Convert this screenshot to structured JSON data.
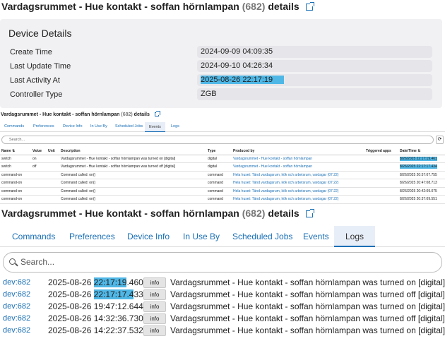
{
  "device_name": "Vardagsrummet - Hue kontakt - soffan hörnlampan",
  "device_count": "(682)",
  "details_word": "details",
  "panel1": {
    "heading": "Device Details",
    "rows": [
      {
        "label": "Create Time",
        "value": "2024-09-09 04:09:35"
      },
      {
        "label": "Last Update Time",
        "value": "2024-09-10 04:26:34"
      },
      {
        "label": "Last Activity At",
        "value": "2025-08-26 22:17:19"
      },
      {
        "label": "Controller Type",
        "value": "ZGB"
      }
    ]
  },
  "panel2": {
    "tabs": [
      "Commands",
      "Preferences",
      "Device Info",
      "In Use By",
      "Scheduled Jobs",
      "Events",
      "Logs"
    ],
    "active_tab": "Events",
    "search_placeholder": "Search...",
    "columns": [
      "Name ⇅",
      "Value",
      "Unit",
      "Description",
      "Type",
      "Produced by",
      "Triggered apps",
      "Date/Time ⇅"
    ],
    "rows": [
      [
        "switch",
        "on",
        "",
        "Vardagsrummet - Hue kontakt - soffan hörnlampan was turned on [digital]",
        "digital",
        "Vardagsrummet - Hue kontakt - soffan hörnlampan",
        "",
        "8/26/2025 22:17:19.461"
      ],
      [
        "switch",
        "off",
        "",
        "Vardagsrummet - Hue kontakt - soffan hörnlampan was turned off [digital]",
        "digital",
        "Vardagsrummet - Hue kontakt - soffan hörnlampan",
        "",
        "8/26/2025 22:17:17.434"
      ],
      [
        "command-on",
        "",
        "",
        "Command called: on()",
        "command",
        "Hela huset: Tänd vardagsrum, kök och arbetsrum, vardagar (07:22)",
        "",
        "8/26/2025 20:57:07.755"
      ],
      [
        "command-on",
        "",
        "",
        "Command called: on()",
        "command",
        "Hela huset: Tänd vardagsrum, kök och arbetsrum, vardagar (07:22)",
        "",
        "8/26/2025 20:47:08.713"
      ],
      [
        "command-on",
        "",
        "",
        "Command called: on()",
        "command",
        "Hela huset: Tänd vardagsrum, kök och arbetsrum, vardagar (07:22)",
        "",
        "8/26/2025 20:42:09.075"
      ],
      [
        "command-on",
        "",
        "",
        "Command called: on()",
        "command",
        "Hela huset: Tänd vardagsrum, kök och arbetsrum, vardagar (07:22)",
        "",
        "8/26/2025 20:37:09.551"
      ]
    ]
  },
  "panel3": {
    "tabs": [
      "Commands",
      "Preferences",
      "Device Info",
      "In Use By",
      "Scheduled Jobs",
      "Events",
      "Logs"
    ],
    "active_tab": "Logs",
    "search_placeholder": "Search...",
    "logs": [
      {
        "source": "dev:682",
        "date": "2025-08-26",
        "time": "22:17:19",
        "ms": ".460",
        "level": "info",
        "message": "Vardagsrummet - Hue kontakt - soffan hörnlampan was turned on [digital]"
      },
      {
        "source": "dev:682",
        "date": "2025-08-26",
        "time": "22:17:17.4",
        "ms": "33",
        "level": "info",
        "message": "Vardagsrummet - Hue kontakt - soffan hörnlampan was turned off [digital]"
      },
      {
        "source": "dev:682",
        "date": "2025-08-26",
        "time": "19:47:12.644",
        "ms": "",
        "level": "info",
        "message": "Vardagsrummet - Hue kontakt - soffan hörnlampan was turned on [digital]"
      },
      {
        "source": "dev:682",
        "date": "2025-08-26",
        "time": "14:32:36.730",
        "ms": "",
        "level": "info",
        "message": "Vardagsrummet - Hue kontakt - soffan hörnlampan was turned off [digital]"
      },
      {
        "source": "dev:682",
        "date": "2025-08-26",
        "time": "14:22:37.532",
        "ms": "",
        "level": "info",
        "message": "Vardagsrummet - Hue kontakt - soffan hörnlampan was turned on [digital]"
      }
    ]
  }
}
